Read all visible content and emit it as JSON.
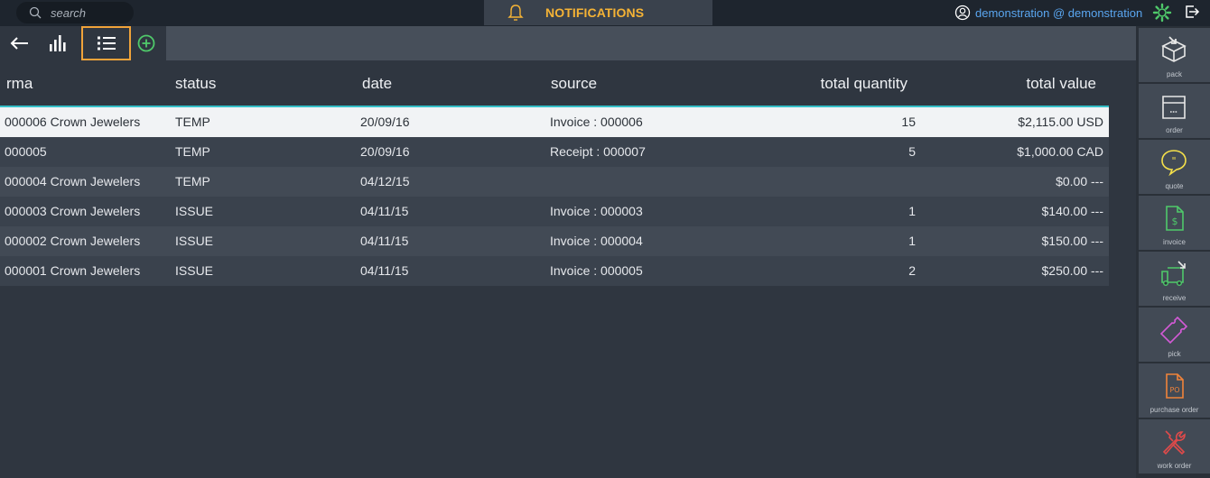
{
  "topbar": {
    "search_placeholder": "search",
    "notifications_label": "NOTIFICATIONS",
    "user_label": "demonstration @ demonstration"
  },
  "toolbar": {
    "buttons": [
      "back-arrow-icon",
      "bar-chart-icon",
      "list-icon",
      "add-circle-icon"
    ],
    "selected": "list-icon"
  },
  "table": {
    "columns": [
      "rma",
      "status",
      "date",
      "source",
      "total quantity",
      "total value"
    ],
    "rows": [
      {
        "rma": "000006 Crown Jewelers",
        "status": "TEMP",
        "date": "20/09/16",
        "source": "Invoice : 000006",
        "qty": "15",
        "value": "$2,115.00 USD"
      },
      {
        "rma": "000005",
        "status": "TEMP",
        "date": "20/09/16",
        "source": "Receipt : 000007",
        "qty": "5",
        "value": "$1,000.00 CAD"
      },
      {
        "rma": "000004 Crown Jewelers",
        "status": "TEMP",
        "date": "04/12/15",
        "source": "",
        "qty": "",
        "value": "$0.00 ---"
      },
      {
        "rma": "000003 Crown Jewelers",
        "status": "ISSUE",
        "date": "04/11/15",
        "source": "Invoice : 000003",
        "qty": "1",
        "value": "$140.00 ---"
      },
      {
        "rma": "000002 Crown Jewelers",
        "status": "ISSUE",
        "date": "04/11/15",
        "source": "Invoice : 000004",
        "qty": "1",
        "value": "$150.00 ---"
      },
      {
        "rma": "000001 Crown Jewelers",
        "status": "ISSUE",
        "date": "04/11/15",
        "source": "Invoice : 000005",
        "qty": "2",
        "value": "$250.00 ---"
      }
    ]
  },
  "sidebar": {
    "items": [
      {
        "label": "pack",
        "icon": "box-icon",
        "color": "#e8e8e8"
      },
      {
        "label": "order",
        "icon": "store-icon",
        "color": "#e8e8e8"
      },
      {
        "label": "quote",
        "icon": "quote-bubble-icon",
        "color": "#f5e04a"
      },
      {
        "label": "invoice",
        "icon": "invoice-dollar-icon",
        "color": "#4fc96a"
      },
      {
        "label": "receive",
        "icon": "truck-icon",
        "color": "#4fc96a"
      },
      {
        "label": "pick",
        "icon": "ticket-icon",
        "color": "#d35ad6"
      },
      {
        "label": "purchase order",
        "icon": "purchase-order-icon",
        "color": "#f0833a"
      },
      {
        "label": "work order",
        "icon": "tools-icon",
        "color": "#e04a4a"
      }
    ]
  },
  "colors": {
    "accent": "#f0a33a",
    "notification_text": "#f5b335",
    "user_link": "#5aa6f0",
    "header_divider": "#36c0c8"
  }
}
